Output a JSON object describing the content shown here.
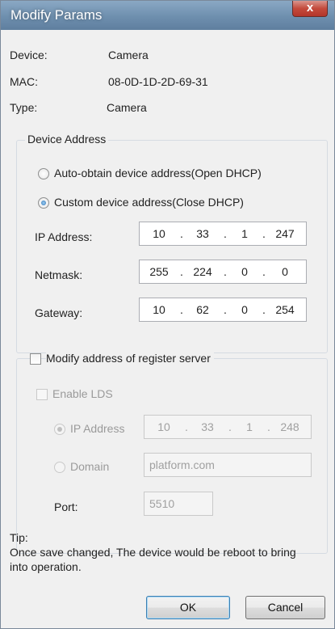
{
  "window": {
    "title": "Modify Params",
    "close_label": "x"
  },
  "info": {
    "device_label": "Device:",
    "device_value": "Camera",
    "mac_label": "MAC:",
    "mac_value": "08-0D-1D-2D-69-31",
    "type_label": "Type:",
    "type_value": "Camera"
  },
  "device_address": {
    "legend": "Device Address",
    "auto_label": "Auto-obtain device address(Open DHCP)",
    "custom_label": "Custom device address(Close DHCP)",
    "selected": "custom",
    "ip_label": "IP Address:",
    "ip": [
      "10",
      "33",
      "1",
      "247"
    ],
    "netmask_label": "Netmask:",
    "netmask": [
      "255",
      "224",
      "0",
      "0"
    ],
    "gateway_label": "Gateway:",
    "gateway": [
      "10",
      "62",
      "0",
      "254"
    ]
  },
  "register_server": {
    "checkbox_label": "Modify address of register server",
    "checked": false,
    "enable_lds_label": "Enable LDS",
    "ip_label": "IP Address",
    "ip": [
      "10",
      "33",
      "1",
      "248"
    ],
    "domain_label": "Domain",
    "domain_value": "platform.com",
    "port_label": "Port:",
    "port_value": "5510"
  },
  "tip": {
    "title": "Tip:",
    "line1": "Once save changed, The device would be reboot to bring",
    "line2": "into operation."
  },
  "buttons": {
    "ok": "OK",
    "cancel": "Cancel"
  }
}
